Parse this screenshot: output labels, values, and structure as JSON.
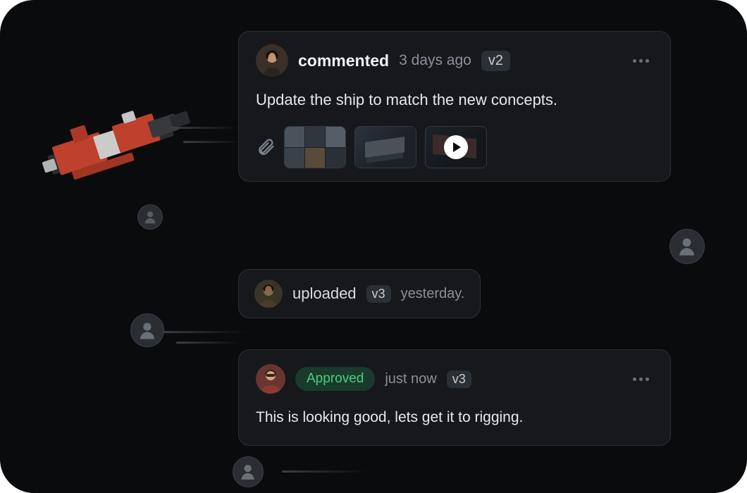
{
  "events": {
    "comment": {
      "action": "commented",
      "timestamp": "3 days ago",
      "version": "v2",
      "body": "Update the ship to match the new concepts.",
      "attachments": [
        "concept-board",
        "ship-iso",
        "ship-video"
      ]
    },
    "upload": {
      "action": "uploaded",
      "version": "v3",
      "timestamp": "yesterday."
    },
    "approval": {
      "status": "Approved",
      "timestamp": "just now",
      "version": "v3",
      "body": "This is looking good, lets get it to rigging."
    }
  },
  "colors": {
    "approved_fg": "#4ad07e",
    "approved_bg": "#1a3b2c"
  }
}
